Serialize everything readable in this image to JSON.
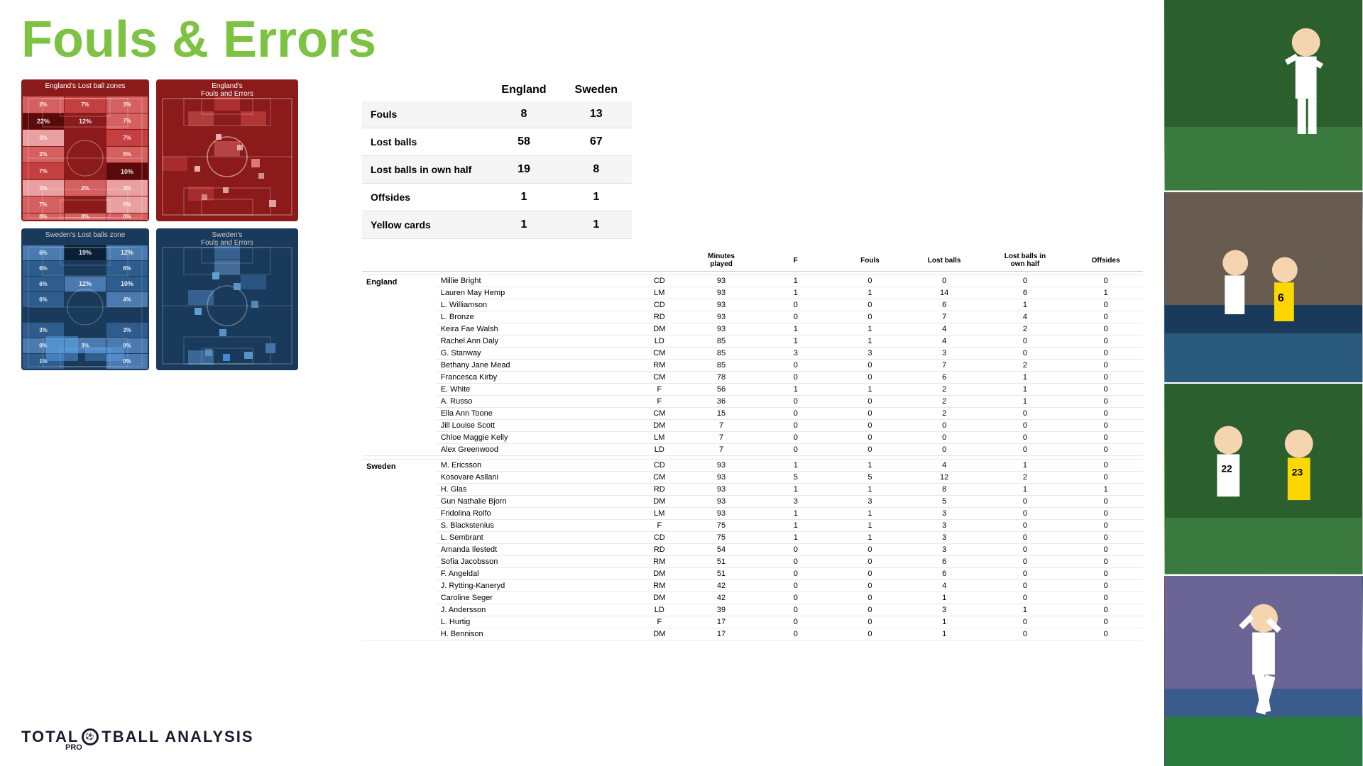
{
  "title": "Fouls & Errors",
  "logo": "TOTAL FOOTBALL ANALYSIS",
  "logo_sub": "PRO",
  "summary_table": {
    "headers": [
      "",
      "England",
      "Sweden"
    ],
    "rows": [
      {
        "metric": "Fouls",
        "england": "8",
        "sweden": "13"
      },
      {
        "metric": "Lost balls",
        "england": "58",
        "sweden": "67"
      },
      {
        "metric": "Lost balls in own half",
        "england": "19",
        "sweden": "8"
      },
      {
        "metric": "Offsides",
        "england": "1",
        "sweden": "1"
      },
      {
        "metric": "Yellow cards",
        "england": "1",
        "sweden": "1"
      }
    ]
  },
  "player_table": {
    "col_headers": [
      "Minutes played",
      "F",
      "Fouls",
      "Lost balls",
      "Lost balls in own half",
      "Offsides"
    ],
    "england_players": [
      {
        "name": "Millie Bright",
        "pos": "CD",
        "min": "93",
        "f": "1",
        "fouls": "0",
        "lost": "0",
        "own_half": "0",
        "offsides": "0"
      },
      {
        "name": "Lauren May Hemp",
        "pos": "LM",
        "min": "93",
        "f": "1",
        "fouls": "1",
        "lost": "14",
        "own_half": "6",
        "offsides": "1"
      },
      {
        "name": "L. Williamson",
        "pos": "CD",
        "min": "93",
        "f": "0",
        "fouls": "0",
        "lost": "6",
        "own_half": "1",
        "offsides": "0"
      },
      {
        "name": "L. Bronze",
        "pos": "RD",
        "min": "93",
        "f": "0",
        "fouls": "0",
        "lost": "7",
        "own_half": "4",
        "offsides": "0"
      },
      {
        "name": "Keira Fae Walsh",
        "pos": "DM",
        "min": "93",
        "f": "1",
        "fouls": "1",
        "lost": "4",
        "own_half": "2",
        "offsides": "0"
      },
      {
        "name": "Rachel Ann Daly",
        "pos": "LD",
        "min": "85",
        "f": "1",
        "fouls": "1",
        "lost": "4",
        "own_half": "0",
        "offsides": "0"
      },
      {
        "name": "G. Stanway",
        "pos": "CM",
        "min": "85",
        "f": "3",
        "fouls": "3",
        "lost": "3",
        "own_half": "0",
        "offsides": "0"
      },
      {
        "name": "Bethany Jane Mead",
        "pos": "RM",
        "min": "85",
        "f": "0",
        "fouls": "0",
        "lost": "7",
        "own_half": "2",
        "offsides": "0"
      },
      {
        "name": "Francesca Kirby",
        "pos": "CM",
        "min": "78",
        "f": "0",
        "fouls": "0",
        "lost": "6",
        "own_half": "1",
        "offsides": "0"
      },
      {
        "name": "E. White",
        "pos": "F",
        "min": "56",
        "f": "1",
        "fouls": "1",
        "lost": "2",
        "own_half": "1",
        "offsides": "0"
      },
      {
        "name": "A. Russo",
        "pos": "F",
        "min": "36",
        "f": "0",
        "fouls": "0",
        "lost": "2",
        "own_half": "1",
        "offsides": "0"
      },
      {
        "name": "Ella Ann Toone",
        "pos": "CM",
        "min": "15",
        "f": "0",
        "fouls": "0",
        "lost": "2",
        "own_half": "0",
        "offsides": "0"
      },
      {
        "name": "Jill Louise Scott",
        "pos": "DM",
        "min": "7",
        "f": "0",
        "fouls": "0",
        "lost": "0",
        "own_half": "0",
        "offsides": "0"
      },
      {
        "name": "Chloe Maggie Kelly",
        "pos": "LM",
        "min": "7",
        "f": "0",
        "fouls": "0",
        "lost": "0",
        "own_half": "0",
        "offsides": "0"
      },
      {
        "name": "Alex Greenwood",
        "pos": "LD",
        "min": "7",
        "f": "0",
        "fouls": "0",
        "lost": "0",
        "own_half": "0",
        "offsides": "0"
      }
    ],
    "sweden_players": [
      {
        "name": "M. Ericsson",
        "pos": "CD",
        "min": "93",
        "f": "1",
        "fouls": "1",
        "lost": "4",
        "own_half": "1",
        "offsides": "0"
      },
      {
        "name": "Kosovare Asllani",
        "pos": "CM",
        "min": "93",
        "f": "5",
        "fouls": "5",
        "lost": "12",
        "own_half": "2",
        "offsides": "0"
      },
      {
        "name": "H. Glas",
        "pos": "RD",
        "min": "93",
        "f": "1",
        "fouls": "1",
        "lost": "8",
        "own_half": "1",
        "offsides": "1"
      },
      {
        "name": "Gun Nathalie Bjorn",
        "pos": "DM",
        "min": "93",
        "f": "3",
        "fouls": "3",
        "lost": "5",
        "own_half": "0",
        "offsides": "0"
      },
      {
        "name": "Fridolina Rolfo",
        "pos": "LM",
        "min": "93",
        "f": "1",
        "fouls": "1",
        "lost": "3",
        "own_half": "0",
        "offsides": "0"
      },
      {
        "name": "S. Blackstenius",
        "pos": "F",
        "min": "75",
        "f": "1",
        "fouls": "1",
        "lost": "3",
        "own_half": "0",
        "offsides": "0"
      },
      {
        "name": "L. Sembrant",
        "pos": "CD",
        "min": "75",
        "f": "1",
        "fouls": "1",
        "lost": "3",
        "own_half": "0",
        "offsides": "0"
      },
      {
        "name": "Amanda Ilestedt",
        "pos": "RD",
        "min": "54",
        "f": "0",
        "fouls": "0",
        "lost": "3",
        "own_half": "0",
        "offsides": "0"
      },
      {
        "name": "Sofia Jacobsson",
        "pos": "RM",
        "min": "51",
        "f": "0",
        "fouls": "0",
        "lost": "6",
        "own_half": "0",
        "offsides": "0"
      },
      {
        "name": "F. Angeldal",
        "pos": "DM",
        "min": "51",
        "f": "0",
        "fouls": "0",
        "lost": "6",
        "own_half": "0",
        "offsides": "0"
      },
      {
        "name": "J. Rytting-Kaneryd",
        "pos": "RM",
        "min": "42",
        "f": "0",
        "fouls": "0",
        "lost": "4",
        "own_half": "0",
        "offsides": "0"
      },
      {
        "name": "Caroline Seger",
        "pos": "DM",
        "min": "42",
        "f": "0",
        "fouls": "0",
        "lost": "1",
        "own_half": "0",
        "offsides": "0"
      },
      {
        "name": "J. Andersson",
        "pos": "LD",
        "min": "39",
        "f": "0",
        "fouls": "0",
        "lost": "3",
        "own_half": "1",
        "offsides": "0"
      },
      {
        "name": "L. Hurtig",
        "pos": "F",
        "min": "17",
        "f": "0",
        "fouls": "0",
        "lost": "1",
        "own_half": "0",
        "offsides": "0"
      },
      {
        "name": "H. Bennison",
        "pos": "DM",
        "min": "17",
        "f": "0",
        "fouls": "0",
        "lost": "1",
        "own_half": "0",
        "offsides": "0"
      }
    ]
  },
  "map_titles": {
    "england_lost": "England's Lost ball zones",
    "england_fouls": "England's\nFouls and Errors",
    "sweden_lost": "Sweden's Lost balls zone",
    "sweden_fouls": "Sweden's\nFouls and Errors"
  },
  "england_lost_heatmap": [
    [
      "2%",
      "7%",
      "3%"
    ],
    [
      "22%",
      "12%",
      "7%",
      "3%",
      "7%"
    ],
    [
      "2%",
      "",
      "",
      "",
      "5%"
    ],
    [
      "7%",
      "",
      "",
      "",
      "10%"
    ],
    [
      "3%",
      "2%",
      "3%"
    ],
    [
      "7%",
      "",
      "",
      "",
      "0%"
    ],
    [
      "0%",
      "0%",
      "0%"
    ]
  ],
  "colors": {
    "title": "#7dc242",
    "england_pitch": "#8b1a1a",
    "sweden_pitch": "#1a3a5c",
    "accent_green": "#7dc242"
  }
}
